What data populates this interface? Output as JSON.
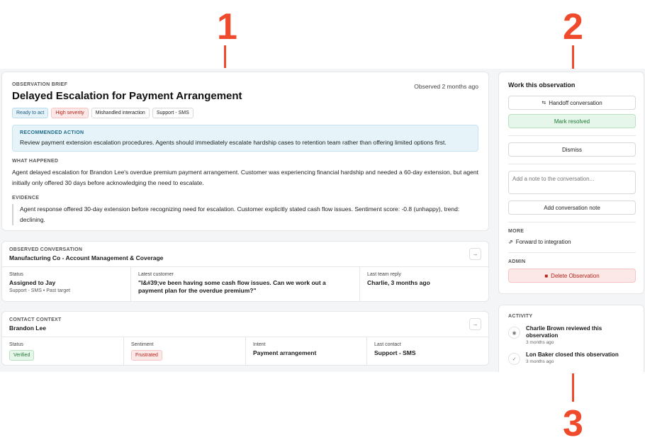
{
  "callouts": [
    "1",
    "2",
    "3"
  ],
  "brief": {
    "eyebrow": "OBSERVATION BRIEF",
    "title": "Delayed Escalation for Payment Arrangement",
    "observed": "Observed 2 months ago",
    "tags": [
      "Ready to act",
      "High severity",
      "Mishandled interaction",
      "Support - SMS"
    ],
    "recommended_label": "RECOMMENDED ACTION",
    "recommended_text": "Review payment extension escalation procedures. Agents should immediately escalate hardship cases to retention team rather than offering limited options first.",
    "what_label": "WHAT HAPPENED",
    "what_text": "Agent delayed escalation for Brandon Lee's overdue premium payment arrangement. Customer was experiencing financial hardship and needed a 60-day extension, but agent initially only offered 30 days before acknowledging the need to escalate.",
    "evidence_label": "EVIDENCE",
    "evidence_text": "Agent response offered 30-day extension before recognizing need for escalation. Customer explicitly stated cash flow issues. Sentiment score: -0.8 (unhappy), trend: declining."
  },
  "conversation": {
    "eyebrow": "OBSERVED CONVERSATION",
    "name": "Manufacturing Co - Account Management & Coverage",
    "status_label": "Status",
    "status_value": "Assigned to Jay",
    "status_sub": "Support - SMS • Past target",
    "latest_label": "Latest customer",
    "latest_value": "\"I&#39;ve been having some cash flow issues. Can we work out a payment plan for the overdue premium?\"",
    "reply_label": "Last team reply",
    "reply_value": "Charlie, 3 months ago"
  },
  "contact": {
    "eyebrow": "CONTACT CONTEXT",
    "name": "Brandon Lee",
    "status_label": "Status",
    "status_value": "Verified",
    "sentiment_label": "Sentiment",
    "sentiment_value": "Frustrated",
    "intent_label": "Intent",
    "intent_value": "Payment arrangement",
    "last_label": "Last contact",
    "last_value": "Support - SMS"
  },
  "work": {
    "title": "Work this observation",
    "handoff": "Handoff conversation",
    "resolve": "Mark resolved",
    "dismiss": "Dismiss",
    "note_placeholder": "Add a note to the conversation...",
    "add_note": "Add conversation note",
    "more_label": "MORE",
    "forward": "Forward to integration",
    "admin_label": "ADMIN",
    "delete": "Delete Observation"
  },
  "activity": {
    "label": "ACTIVITY",
    "items": [
      {
        "text": "Charlie Brown reviewed this observation",
        "time": "3 months ago",
        "icon": "eye-icon"
      },
      {
        "text": "Lon Baker closed this observation",
        "time": "3 months ago",
        "icon": "check-icon"
      }
    ]
  },
  "colors": {
    "accent_callout": "#f04a2c",
    "success": "#1f7a38",
    "danger": "#b42318",
    "info": "#1f6a8a"
  }
}
